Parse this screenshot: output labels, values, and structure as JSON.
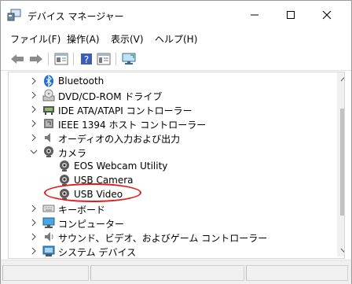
{
  "window": {
    "title": "デバイス マネージャー"
  },
  "menubar": {
    "items": [
      "ファイル(F)",
      "操作(A)",
      "表示(V)",
      "ヘルプ(H)"
    ]
  },
  "toolbar": {
    "buttons": [
      "back-arrow-icon",
      "forward-arrow-icon",
      "properties-icon",
      "help-icon",
      "device-view-icon",
      "monitor-icon"
    ]
  },
  "tree": {
    "items": [
      {
        "label": "Bluetooth",
        "level": 0,
        "expanded": false,
        "icon": "bluetooth-icon"
      },
      {
        "label": "DVD/CD-ROM ドライブ",
        "level": 0,
        "expanded": false,
        "icon": "dvd-drive-icon"
      },
      {
        "label": "IDE ATA/ATAPI コントローラー",
        "level": 0,
        "expanded": false,
        "icon": "ide-controller-icon"
      },
      {
        "label": "IEEE 1394 ホスト コントローラー",
        "level": 0,
        "expanded": false,
        "icon": "ieee1394-icon"
      },
      {
        "label": "オーディオの入力および出力",
        "level": 0,
        "expanded": false,
        "icon": "audio-icon"
      },
      {
        "label": "カメラ",
        "level": 0,
        "expanded": true,
        "icon": "camera-icon"
      },
      {
        "label": "EOS Webcam Utility",
        "level": 1,
        "icon": "webcam-icon"
      },
      {
        "label": "USB Camera",
        "level": 1,
        "icon": "webcam-icon"
      },
      {
        "label": "USB Video",
        "level": 1,
        "icon": "webcam-icon",
        "circled": true
      },
      {
        "label": "キーボード",
        "level": 0,
        "expanded": false,
        "icon": "keyboard-icon"
      },
      {
        "label": "コンピューター",
        "level": 0,
        "expanded": false,
        "icon": "computer-icon"
      },
      {
        "label": "サウンド、ビデオ、およびゲーム コントローラー",
        "level": 0,
        "expanded": false,
        "icon": "speaker-icon"
      },
      {
        "label": "システム デバイス",
        "level": 0,
        "expanded": false,
        "icon": "system-device-icon"
      }
    ]
  },
  "colors": {
    "highlight": "#e21b1b",
    "bluetooth": "#1e6ed4"
  }
}
